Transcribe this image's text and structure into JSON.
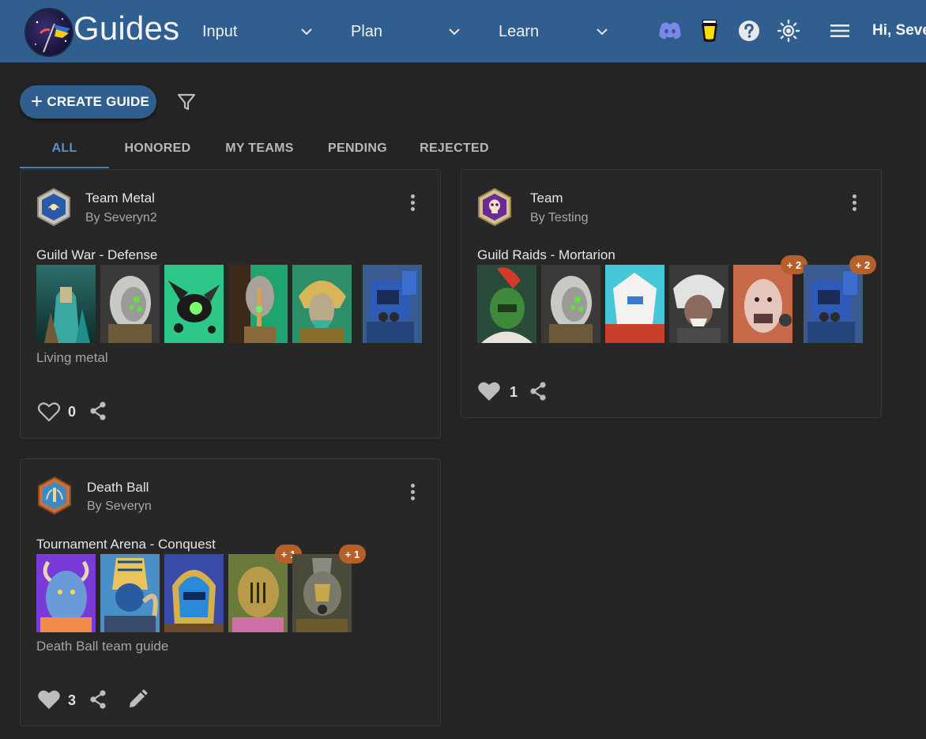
{
  "app": {
    "title": "Guides",
    "greeting": "Hi, Seve"
  },
  "nav": [
    {
      "label": "Input"
    },
    {
      "label": "Plan"
    },
    {
      "label": "Learn"
    }
  ],
  "toolbar": {
    "create_label": "CREATE GUIDE"
  },
  "tabs": [
    {
      "label": "ALL",
      "active": true
    },
    {
      "label": "HONORED",
      "active": false
    },
    {
      "label": "MY TEAMS",
      "active": false
    },
    {
      "label": "PENDING",
      "active": false
    },
    {
      "label": "REJECTED",
      "active": false
    }
  ],
  "colors": {
    "header": "#2f5e8f",
    "background": "#242424",
    "card": "#272727",
    "accent": "#5b8fc7",
    "badge": "#b5602a"
  },
  "guides": [
    {
      "title": "Team Metal",
      "author": "By Severyn2",
      "mode": "Guild War - Defense",
      "description": "Living metal",
      "likes": "0",
      "liked": false,
      "rank_icon": "silver-rank-icon",
      "portraits": [
        {
          "name": "teal-robed-necron",
          "extra": ""
        },
        {
          "name": "necron-skull-green-eyes",
          "extra": ""
        },
        {
          "name": "scarab-swarm",
          "extra": ""
        },
        {
          "name": "necron-staff-bearer",
          "extra": ""
        },
        {
          "name": "gold-necron-lord",
          "extra": ""
        },
        {
          "name": "ultramarine-dreadnought",
          "extra": ""
        }
      ]
    },
    {
      "title": "Team",
      "author": "By Testing",
      "mode": "Guild Raids - Mortarion",
      "description": "",
      "likes": "1",
      "liked": true,
      "rank_icon": "purple-skull-rank-icon",
      "portraits": [
        {
          "name": "green-plumed-marine",
          "extra": ""
        },
        {
          "name": "necron-skull-green-eyes",
          "extra": ""
        },
        {
          "name": "white-tau-suit",
          "extra": ""
        },
        {
          "name": "white-haired-ork",
          "extra": ""
        },
        {
          "name": "pale-cultist",
          "extra": "+ 2"
        },
        {
          "name": "ultramarine-dreadnought",
          "extra": "+ 2"
        }
      ]
    },
    {
      "title": "Death Ball",
      "author": "By Severyn",
      "mode": "Tournament Arena - Conquest",
      "description": "Death Ball team guide",
      "likes": "3",
      "liked": true,
      "editable": true,
      "rank_icon": "bronze-rank-icon",
      "portraits": [
        {
          "name": "blue-daemon",
          "extra": ""
        },
        {
          "name": "thousand-sons-sorcerer",
          "extra": ""
        },
        {
          "name": "thousand-sons-marine",
          "extra": ""
        },
        {
          "name": "plague-marine-gold",
          "extra": "+ 1"
        },
        {
          "name": "plague-marine-grey",
          "extra": "+ 1"
        }
      ]
    }
  ]
}
